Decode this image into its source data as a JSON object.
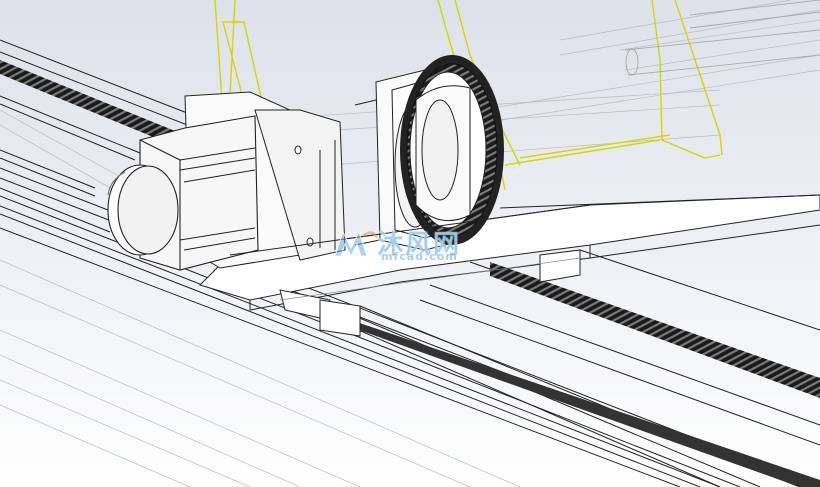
{
  "viewport": {
    "background_top": "#dfe3ec",
    "background_bottom": "#ffffff",
    "line_color": "#2a2a2a",
    "hidden_line_color": "#9a9aa0",
    "selection_color": "#d6d600"
  },
  "watermark": {
    "title": "沐风网",
    "url": "mfcad.com",
    "color": "#5aaae1"
  }
}
